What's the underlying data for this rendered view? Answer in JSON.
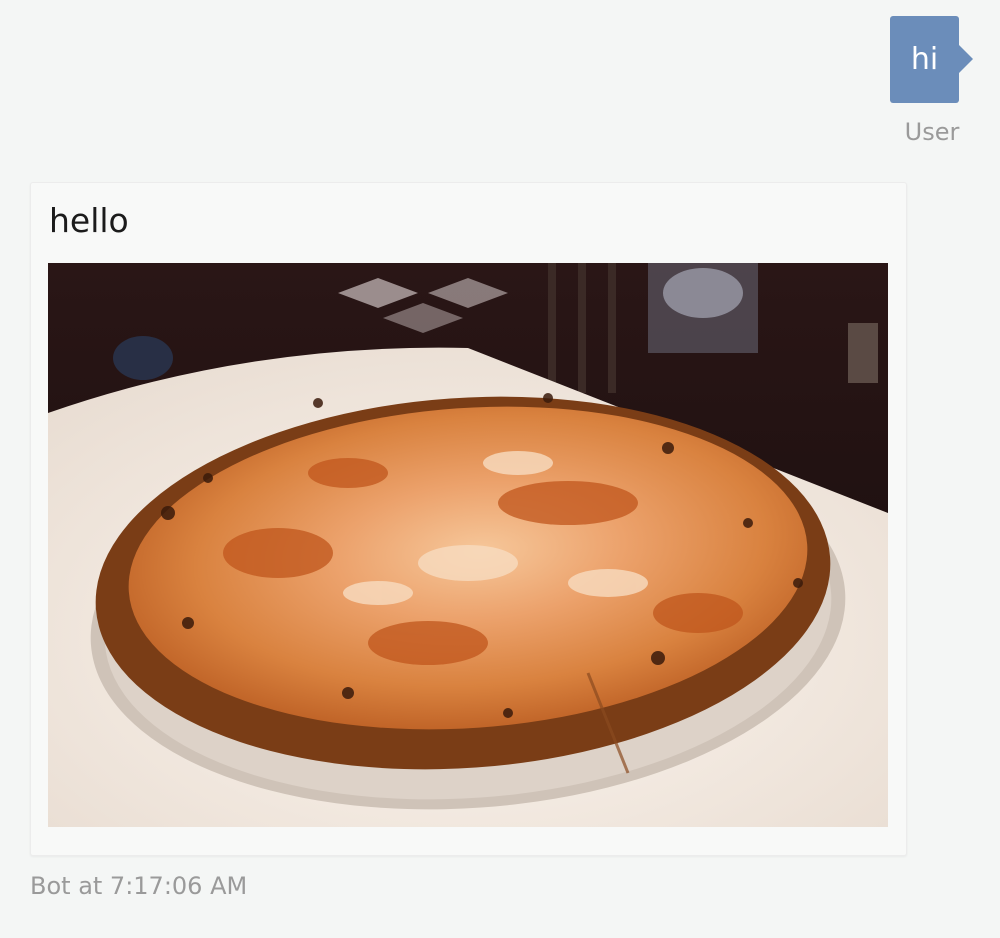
{
  "conversation": {
    "user_message": {
      "text": "hi",
      "sender_label": "User",
      "bubble_color": "#6b8dba"
    },
    "bot_message": {
      "text": "hello",
      "image_subject": "pizza-photo",
      "footer": "Bot at 7:17:06 AM"
    }
  }
}
